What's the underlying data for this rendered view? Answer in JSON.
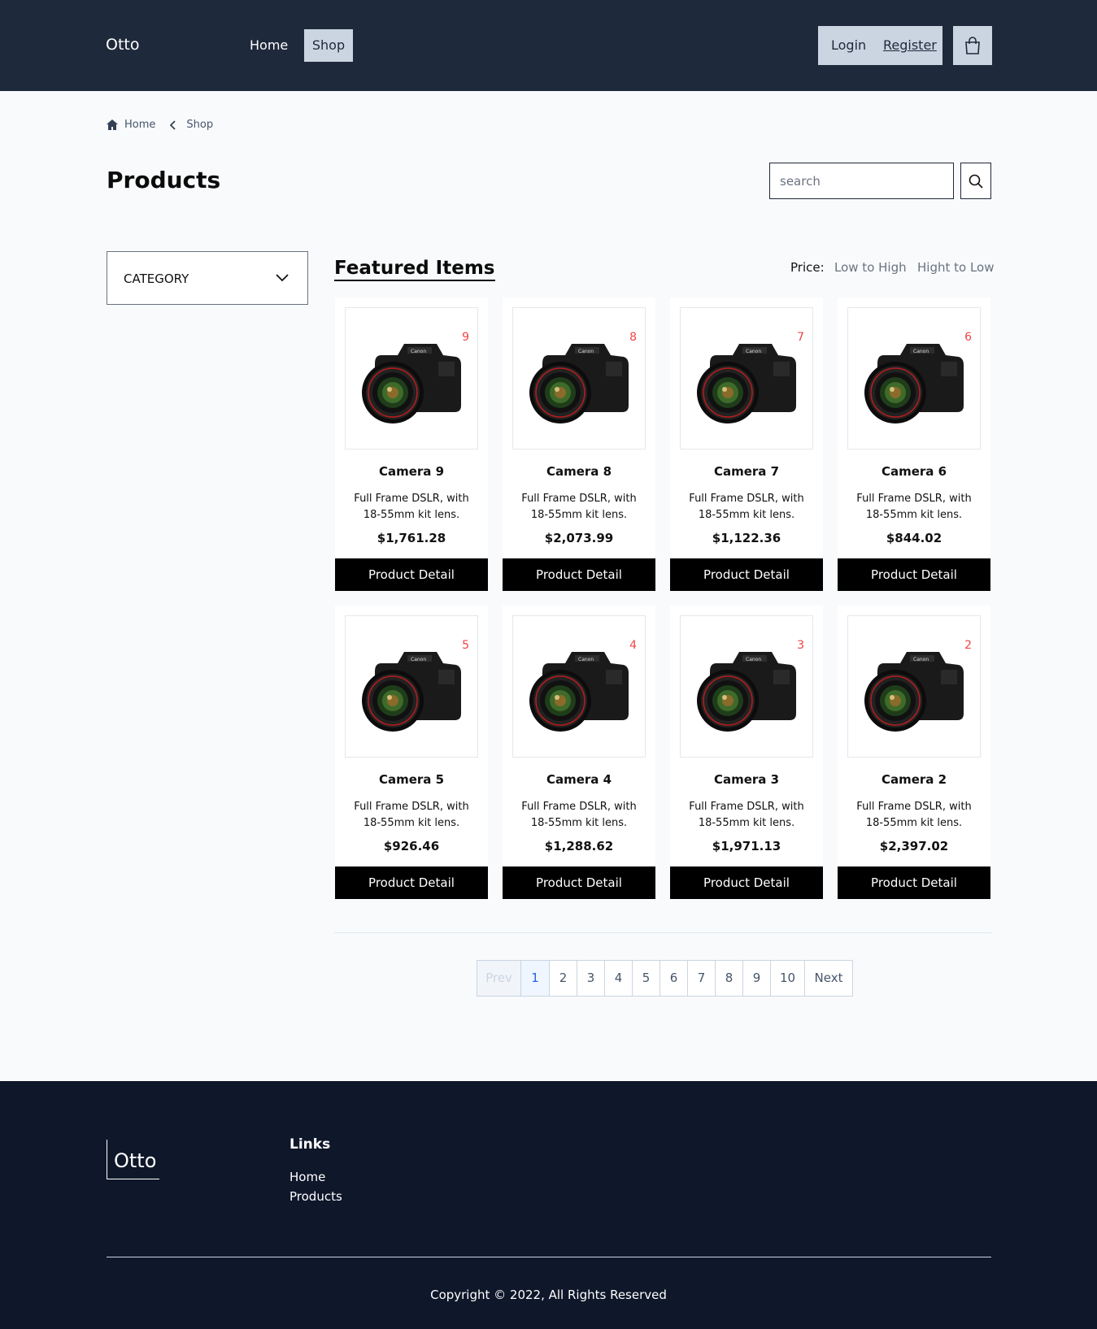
{
  "header": {
    "brand": "Otto",
    "nav": {
      "home": "Home",
      "shop": "Shop"
    },
    "auth": {
      "login": "Login",
      "register": "Register"
    },
    "cart_icon": "shopping-bag-icon"
  },
  "breadcrumb": {
    "home": "Home",
    "current": "Shop"
  },
  "page_title": "Products",
  "search": {
    "placeholder": "search",
    "icon": "search-icon"
  },
  "category": {
    "label": "CATEGORY",
    "icon": "chevron-down-icon"
  },
  "featured": {
    "title": "Featured Items",
    "sort_label": "Price:",
    "sort_low": "Low to High",
    "sort_high": "Hight to Low"
  },
  "products": [
    {
      "badge": "9",
      "name": "Camera 9",
      "desc": "Full Frame DSLR, with 18-55mm kit lens.",
      "price": "$1,761.28",
      "button": "Product Detail"
    },
    {
      "badge": "8",
      "name": "Camera 8",
      "desc": "Full Frame DSLR, with 18-55mm kit lens.",
      "price": "$2,073.99",
      "button": "Product Detail"
    },
    {
      "badge": "7",
      "name": "Camera 7",
      "desc": "Full Frame DSLR, with 18-55mm kit lens.",
      "price": "$1,122.36",
      "button": "Product Detail"
    },
    {
      "badge": "6",
      "name": "Camera 6",
      "desc": "Full Frame DSLR, with 18-55mm kit lens.",
      "price": "$844.02",
      "button": "Product Detail"
    },
    {
      "badge": "5",
      "name": "Camera 5",
      "desc": "Full Frame DSLR, with 18-55mm kit lens.",
      "price": "$926.46",
      "button": "Product Detail"
    },
    {
      "badge": "4",
      "name": "Camera 4",
      "desc": "Full Frame DSLR, with 18-55mm kit lens.",
      "price": "$1,288.62",
      "button": "Product Detail"
    },
    {
      "badge": "3",
      "name": "Camera 3",
      "desc": "Full Frame DSLR, with 18-55mm kit lens.",
      "price": "$1,971.13",
      "button": "Product Detail"
    },
    {
      "badge": "2",
      "name": "Camera 2",
      "desc": "Full Frame DSLR, with 18-55mm kit lens.",
      "price": "$2,397.02",
      "button": "Product Detail"
    }
  ],
  "pagination": {
    "prev": "Prev",
    "pages": [
      "1",
      "2",
      "3",
      "4",
      "5",
      "6",
      "7",
      "8",
      "9",
      "10"
    ],
    "active": "1",
    "next": "Next"
  },
  "footer": {
    "brand": "Otto",
    "links_title": "Links",
    "links": [
      "Home",
      "Products"
    ],
    "copyright": "Copyright © 2022, All Rights Reserved"
  },
  "colors": {
    "header_bg": "#1e293b",
    "footer_bg": "#0f172a",
    "accent_light": "#cbd5e1",
    "badge": "#ef4444",
    "active_page": "#2563eb"
  }
}
